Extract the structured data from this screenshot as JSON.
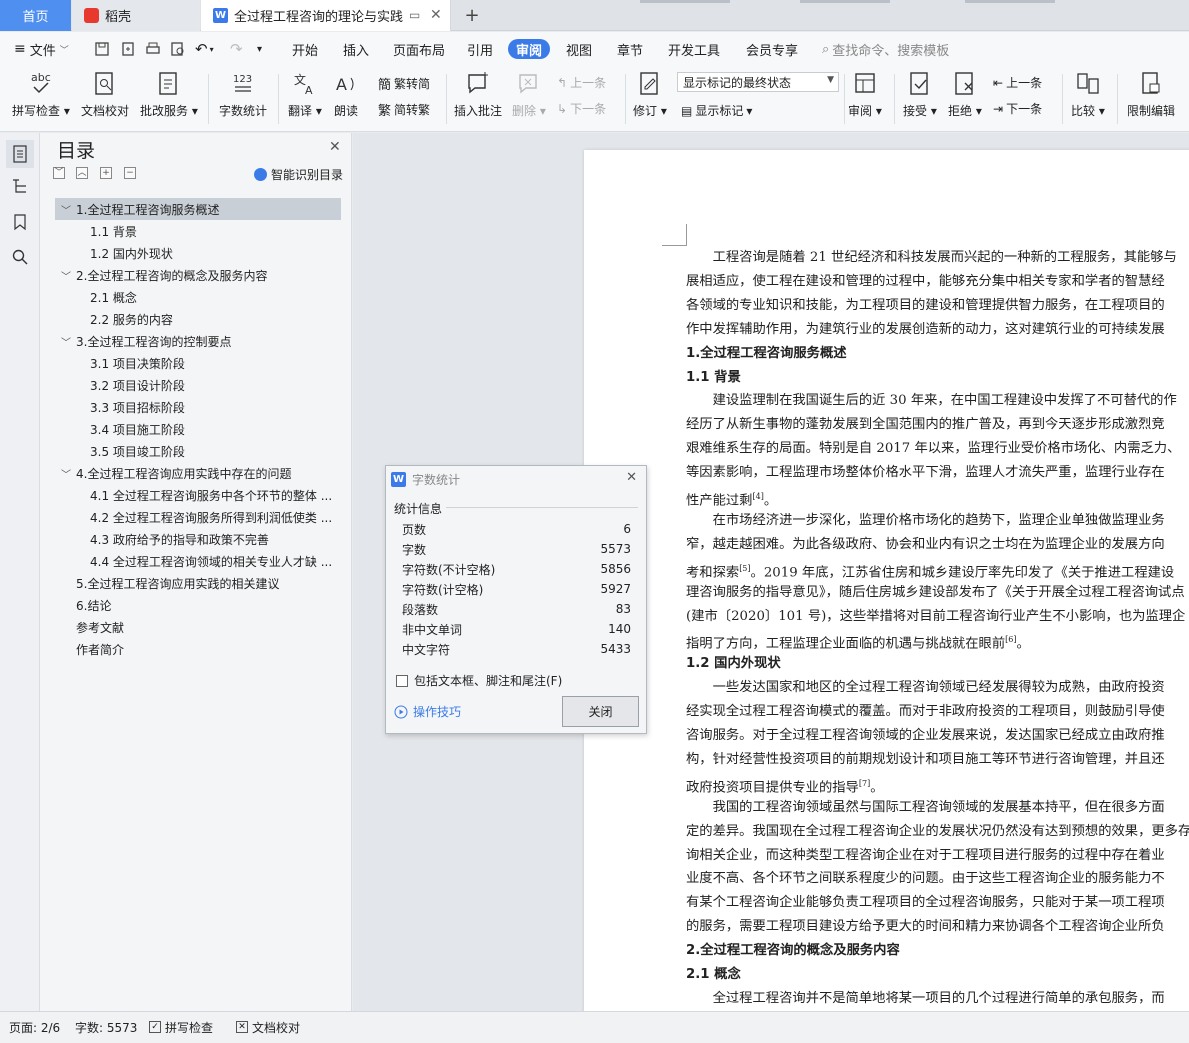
{
  "tabs": {
    "home": "首页",
    "daoke": "稻壳",
    "doc": "全过程工程咨询的理论与实践",
    "plus": "+"
  },
  "menu": {
    "file": "文件",
    "items": [
      "开始",
      "插入",
      "页面布局",
      "引用",
      "审阅",
      "视图",
      "章节",
      "开发工具",
      "会员专享"
    ],
    "active": "审阅",
    "search": "查找命令、搜索模板"
  },
  "toolbar": {
    "spell": "拼写检查",
    "doccheck": "文档校对",
    "correct": "批改服务",
    "wordcount": "字数统计",
    "translate": "翻译",
    "read": "朗读",
    "t2s": "繁转简",
    "s2t": "简转繁",
    "insert_comment": "插入批注",
    "delete": "删除",
    "prev_comment": "上一条",
    "next_comment": "下一条",
    "revise": "修订",
    "markup_state": "显示标记的最终状态",
    "show_markup": "显示标记",
    "review": "审阅",
    "accept": "接受",
    "reject": "拒绝",
    "prev": "上一条",
    "next": "下一条",
    "compare": "比较",
    "restrict": "限制编辑"
  },
  "nav": {
    "title": "目录",
    "smart": "智能识别目录",
    "items": [
      {
        "label": "1.全过程工程咨询服务概述",
        "level": 1,
        "expanded": true,
        "selected": true
      },
      {
        "label": "1.1 背景",
        "level": 2
      },
      {
        "label": "1.2 国内外现状",
        "level": 2
      },
      {
        "label": "2.全过程工程咨询的概念及服务内容",
        "level": 1,
        "expanded": true
      },
      {
        "label": "2.1 概念",
        "level": 2
      },
      {
        "label": "2.2 服务的内容",
        "level": 2
      },
      {
        "label": "3.全过程工程咨询的控制要点",
        "level": 1,
        "expanded": true
      },
      {
        "label": "3.1 项目决策阶段",
        "level": 2
      },
      {
        "label": "3.2 项目设计阶段",
        "level": 2
      },
      {
        "label": "3.3 项目招标阶段",
        "level": 2
      },
      {
        "label": "3.4 项目施工阶段",
        "level": 2
      },
      {
        "label": "3.5 项目竣工阶段",
        "level": 2
      },
      {
        "label": "4.全过程工程咨询应用实践中存在的问题",
        "level": 1,
        "expanded": true
      },
      {
        "label": "4.1 全过程工程咨询服务中各个环节的整体 ...",
        "level": 2
      },
      {
        "label": "4.2 全过程工程咨询服务所得到利润低使类 ...",
        "level": 2
      },
      {
        "label": "4.3 政府给予的指导和政策不完善",
        "level": 2
      },
      {
        "label": "4.4 全过程工程咨询领域的相关专业人才缺 ...",
        "level": 2
      },
      {
        "label": "5.全过程工程咨询应用实践的相关建议",
        "level": 1
      },
      {
        "label": "6.结论",
        "level": 1
      },
      {
        "label": "参考文献",
        "level": 1
      },
      {
        "label": "作者简介",
        "level": 1
      }
    ]
  },
  "doc": {
    "lines": [
      {
        "t": "　　工程咨询是随着 21 世纪经济和科技发展而兴起的一种新的工程服务，其能够与"
      },
      {
        "t": "展相适应，使工程在建设和管理的过程中，能够充分集中相关专家和学者的智慧经"
      },
      {
        "t": "各领域的专业知识和技能，为工程项目的建设和管理提供智力服务，在工程项目的"
      },
      {
        "t": "作中发挥辅助作用，为建筑行业的发展创造新的动力，这对建筑行业的可持续发展"
      },
      {
        "t": "1.全过程工程咨询服务概述",
        "h": true
      },
      {
        "t": "1.1 背景",
        "h": true
      },
      {
        "t": "　　建设监理制在我国诞生后的近 30 年来，在中国工程建设中发挥了不可替代的作"
      },
      {
        "t": "经历了从新生事物的蓬勃发展到全国范围内的推广普及，再到今天逐步形成激烈竞"
      },
      {
        "t": "艰难维系生存的局面。特别是自 2017 年以来，监理行业受价格市场化、内需乏力、"
      },
      {
        "t": "等因素影响，工程监理市场整体价格水平下滑，监理人才流失严重，监理行业存在"
      },
      {
        "t": "性产能过剩",
        "sup": "[4]",
        "after": "。"
      },
      {
        "t": "　　在市场经济进一步深化，监理价格市场化的趋势下，监理企业单独做监理业务"
      },
      {
        "t": "窄，越走越困难。为此各级政府、协会和业内有识之士均在为监理企业的发展方向"
      },
      {
        "t": "考和探索",
        "sup": "[5]",
        "after": "。2019 年底，江苏省住房和城乡建设厅率先印发了《关于推进工程建设"
      },
      {
        "t": "理咨询服务的指导意见》，随后住房城乡建设部发布了《关于开展全过程工程咨询试点"
      },
      {
        "t": "(建市〔2020〕101 号)，这些举措将对目前工程咨询行业产生不小影响，也为监理企"
      },
      {
        "t": "指明了方向，工程监理企业面临的机遇与挑战就在眼前",
        "sup": "[6]",
        "after": "。"
      },
      {
        "t": "1.2 国内外现状",
        "h": true
      },
      {
        "t": "　　一些发达国家和地区的全过程工程咨询领域已经发展得较为成熟，由政府投资"
      },
      {
        "t": "经实现全过程工程咨询模式的覆盖。而对于非政府投资的工程项目，则鼓励引导使"
      },
      {
        "t": "咨询服务。对于全过程工程咨询领域的企业发展来说，发达国家已经成立由政府推"
      },
      {
        "t": "构，针对经营性投资项目的前期规划设计和项目施工等环节进行咨询管理，并且还"
      },
      {
        "t": "政府投资项目提供专业的指导",
        "sup": "[7]",
        "after": "。"
      },
      {
        "t": "　　我国的工程咨询领域虽然与国际工程咨询领域的发展基本持平，但在很多方面"
      },
      {
        "t": "定的差异。我国现在全过程工程咨询企业的发展状况仍然没有达到预想的效果，更多存"
      },
      {
        "t": "询相关企业，而这种类型工程咨询企业在对于工程项目进行服务的过程中存在着业"
      },
      {
        "t": "业度不高、各个环节之间联系程度少的问题。由于这些工程咨询企业的服务能力不"
      },
      {
        "t": "有某个工程咨询企业能够负责工程项目的全过程咨询服务，只能对于某一项工程项"
      },
      {
        "t": "的服务，需要工程项目建设方给予更大的时间和精力来协调各个工程咨询企业所负"
      },
      {
        "t": "2.全过程工程咨询的概念及服务内容",
        "h": true
      },
      {
        "t": "2.1 概念",
        "h": true
      },
      {
        "t": "　　全过程工程咨询并不是简单地将某一项目的几个过程进行简单的承包服务，而"
      }
    ]
  },
  "dialog": {
    "title": "字数统计",
    "section": "统计信息",
    "stats": [
      {
        "label": "页数",
        "value": "6"
      },
      {
        "label": "字数",
        "value": "5573"
      },
      {
        "label": "字符数(不计空格)",
        "value": "5856"
      },
      {
        "label": "字符数(计空格)",
        "value": "5927"
      },
      {
        "label": "段落数",
        "value": "83"
      },
      {
        "label": "非中文单词",
        "value": "140"
      },
      {
        "label": "中文字符",
        "value": "5433"
      }
    ],
    "include": "包括文本框、脚注和尾注(F)",
    "tips": "操作技巧",
    "close": "关闭"
  },
  "status": {
    "page": "页面: 2/6",
    "words": "字数: 5573",
    "spell": "拼写检查",
    "doccheck": "文档校对"
  },
  "colors": {
    "accent": "#3a7be8",
    "home_tab": "#4f8ff0",
    "daoke": "#e8392f"
  }
}
